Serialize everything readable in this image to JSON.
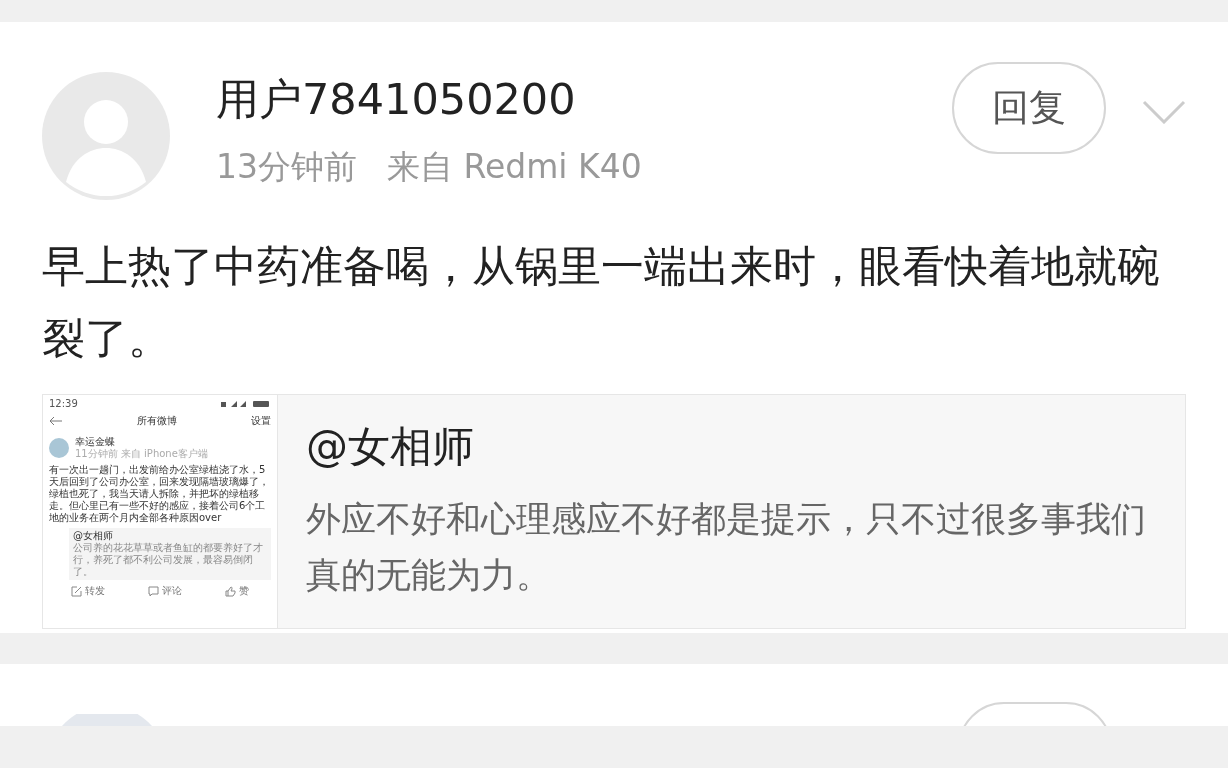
{
  "comment": {
    "username": "用户7841050200",
    "time": "13分钟前",
    "source": "来自 Redmi K40",
    "reply_button": "回复",
    "text": "早上热了中药准备喝，从锅里一端出来时，眼看快着地就碗裂了。",
    "quote": {
      "author": "@女相师",
      "text": "外应不好和心理感应不好都是提示，只不过很多事我们真的无能为力。",
      "thumbnail": {
        "status_time": "12:39",
        "nav_title": "所有微博",
        "nav_right": "设置",
        "user": "幸运金蝶",
        "meta": "11分钟前 来自 iPhone客户端",
        "body": "有一次出一趟门，出发前给办公室绿植浇了水，5天后回到了公司办公室，回来发现隔墙玻璃爆了，绿植也死了，我当天请人拆除，并把坏的绿植移走。但心里已有一些不好的感应，接着公司6个工地的业务在两个月内全部各种原因over",
        "quote_author": "@女相师",
        "quote_text": "公司养的花花草草或者鱼缸的都要养好了才行，养死了都不利公司发展，最容易倒闭了。",
        "actions": [
          {
            "kind": "share",
            "label": "转发"
          },
          {
            "kind": "comment",
            "label": "评论"
          },
          {
            "kind": "like",
            "label": "赞"
          }
        ]
      }
    }
  }
}
